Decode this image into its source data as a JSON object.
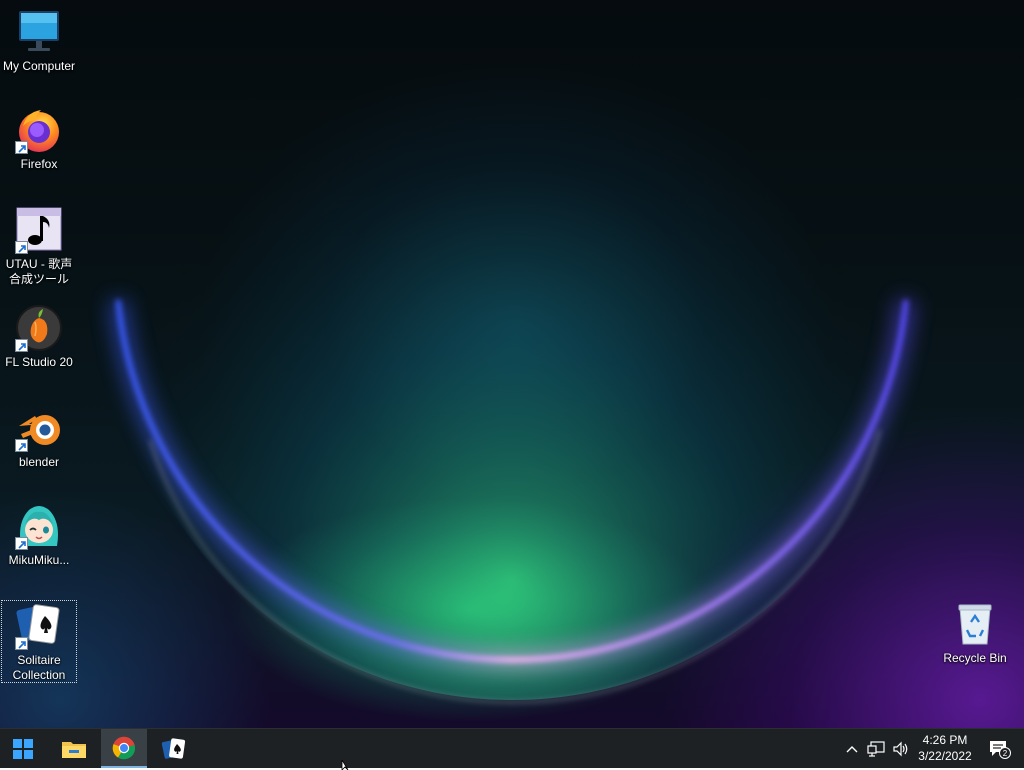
{
  "desktop": {
    "icons": [
      {
        "label": "My Computer"
      },
      {
        "label": "Firefox"
      },
      {
        "label": "UTAU - 歌声合成ツール"
      },
      {
        "label": "FL Studio 20"
      },
      {
        "label": "blender"
      },
      {
        "label": "MikuMiku..."
      },
      {
        "label": "Solitaire Collection"
      },
      {
        "label": "Recycle Bin"
      }
    ]
  },
  "taskbar": {
    "buttons": [
      {
        "icon": "windows-start-icon"
      },
      {
        "icon": "file-explorer-icon"
      },
      {
        "icon": "chrome-icon",
        "active": true
      },
      {
        "icon": "solitaire-icon"
      }
    ],
    "tray": {
      "icons": [
        "chevron-up-icon",
        "network-icon",
        "volume-icon"
      ],
      "time": "4:26 PM",
      "date": "3/22/2022",
      "notification_count": "2"
    }
  },
  "colors": {
    "taskbar_bg": "#1d2123",
    "active_underline": "#7fb3e0",
    "wallpaper_glow_green": "#2ad07a",
    "wallpaper_glow_purple": "#7a2ed0"
  }
}
